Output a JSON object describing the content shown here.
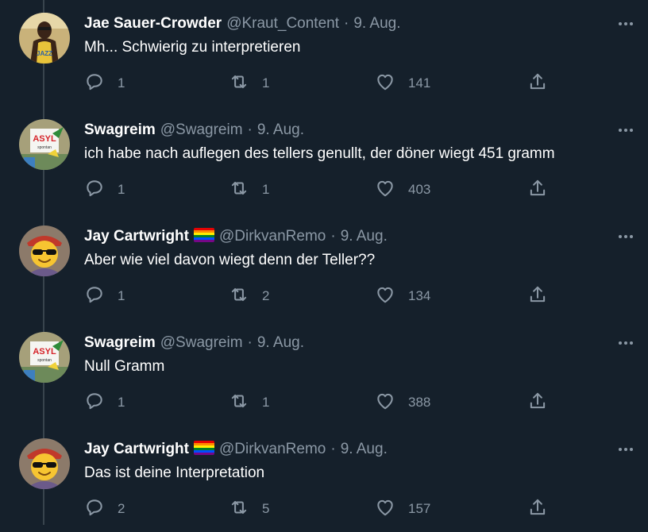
{
  "colors": {
    "background": "#15202b",
    "text": "#ffffff",
    "muted": "#8b98a5",
    "thread_line": "#38444d"
  },
  "tweets": [
    {
      "name": "Jae Sauer-Crowder",
      "flag": false,
      "handle": "@Kraut_Content",
      "sep": "·",
      "date": "9. Aug.",
      "text": "Mh... Schwierig zu interpretieren",
      "replies": "1",
      "retweets": "1",
      "likes": "141",
      "avatar": "basketball-player"
    },
    {
      "name": "Swagreim",
      "flag": false,
      "handle": "@Swagreim",
      "sep": "·",
      "date": "9. Aug.",
      "text": "ich habe nach auflegen des tellers genullt, der döner wiegt 451 gramm",
      "replies": "1",
      "retweets": "1",
      "likes": "403",
      "avatar": "sign-hat"
    },
    {
      "name": "Jay Cartwright",
      "flag": true,
      "handle": "@DirkvanRemo",
      "sep": "·",
      "date": "9. Aug.",
      "text": "Aber wie viel davon wiegt denn der Teller??",
      "replies": "1",
      "retweets": "2",
      "likes": "134",
      "avatar": "sunglasses-smiley"
    },
    {
      "name": "Swagreim",
      "flag": false,
      "handle": "@Swagreim",
      "sep": "·",
      "date": "9. Aug.",
      "text": "Null Gramm",
      "replies": "1",
      "retweets": "1",
      "likes": "388",
      "avatar": "sign-hat"
    },
    {
      "name": "Jay Cartwright",
      "flag": true,
      "handle": "@DirkvanRemo",
      "sep": "·",
      "date": "9. Aug.",
      "text": "Das ist deine Interpretation",
      "replies": "2",
      "retweets": "5",
      "likes": "157",
      "avatar": "sunglasses-smiley"
    }
  ],
  "avatar_texts": {
    "sign": "ASYL",
    "sign_sub": "spontan"
  },
  "icons": {
    "reply": "reply-icon",
    "retweet": "retweet-icon",
    "like": "heart-icon",
    "share": "share-icon",
    "more": "more-icon",
    "flag": "rainbow-flag-icon"
  }
}
